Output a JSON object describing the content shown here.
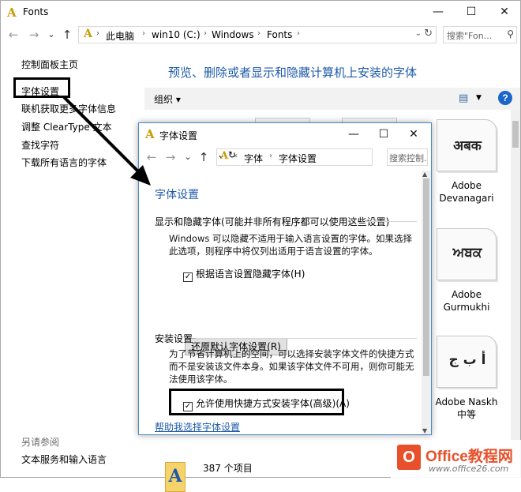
{
  "window": {
    "title": "Fonts",
    "controls": {
      "minimize": "—",
      "maximize": "☐",
      "close": "✕"
    }
  },
  "nav": {
    "back": "←",
    "forward": "→",
    "recent": "⌄",
    "up": "↑",
    "breadcrumbs": [
      "此电脑",
      "win10 (C:)",
      "Windows",
      "Fonts"
    ],
    "search_placeholder": "搜索\"Fon...",
    "refresh": "↻"
  },
  "sidebar": {
    "items": [
      {
        "label": "控制面板主页"
      },
      {
        "label": "字体设置"
      },
      {
        "label": "联机获取更多字体信息"
      },
      {
        "label": "调整 ClearType 文本"
      },
      {
        "label": "查找字符"
      },
      {
        "label": "下载所有语言的字体"
      }
    ],
    "see_also": "另请参阅",
    "see_also_link": "文本服务和输入语言"
  },
  "main": {
    "title": "预览、删除或者显示和隐藏计算机上安装的字体",
    "toolbar": {
      "organize": "组织",
      "help": "?"
    },
    "fonts": [
      {
        "glyph": "अबक",
        "name": "Adobe Devanagari"
      },
      {
        "glyph": "ਅਬਕ",
        "name": "Adobe Gurmukhi"
      },
      {
        "glyph": "أ ب ج",
        "name": "Adobe Naskh 中等"
      }
    ],
    "status": "387 个项目"
  },
  "dialog": {
    "title": "字体设置",
    "breadcrumbs": [
      "字体",
      "字体设置"
    ],
    "search_placeholder": "搜索控制...",
    "heading": "字体设置",
    "group1": {
      "label": "显示和隐藏字体(可能并非所有程序都可以使用这些设置)",
      "text": "Windows 可以隐藏不适用于输入语言设置的字体。如果选择此选项，则程序中将仅列出适用于语言设置的字体。",
      "checkbox": "根据语言设置隐藏字体(H)",
      "checked": true,
      "button": "还原默认字体设置(R)"
    },
    "group2": {
      "label": "安装设置",
      "text": "为了节省计算机上的空间，可以选择安装字体文件的快捷方式而不是安装该文件本身。如果该字体文件不可用，则你可能无法使用该字体。",
      "checkbox": "允许使用快捷方式安装字体(高级)(A)",
      "checked": true
    },
    "help_link": "帮助我选择字体设置"
  },
  "watermark": {
    "brand": "Office教程网",
    "site": "www.office26.com",
    "logo": "O"
  },
  "colors": {
    "link_blue": "#1e5aa8",
    "accent": "#1a66c9",
    "dialog_border": "#4a88c7",
    "watermark": "#e8502b"
  }
}
